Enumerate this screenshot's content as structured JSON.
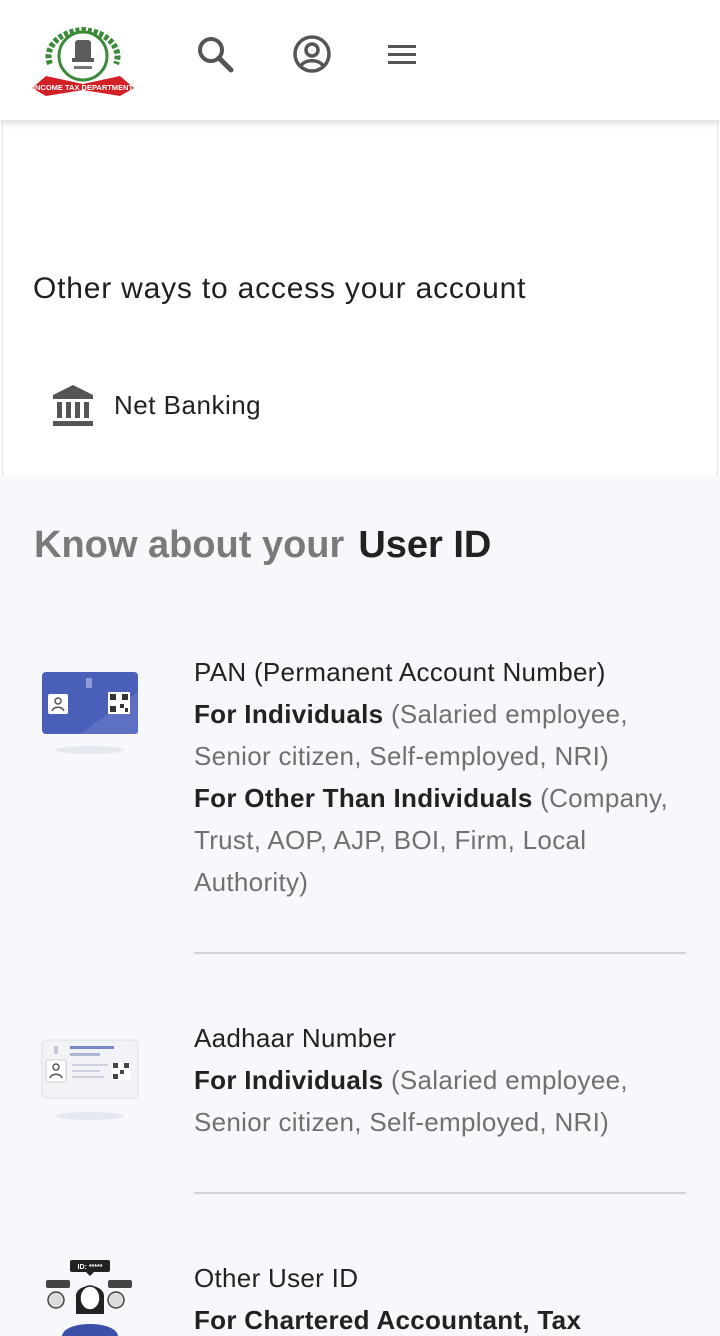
{
  "header": {
    "logo_text": "INCOME TAX DEPARTMENT",
    "icons": [
      "search-icon",
      "account-circle-icon",
      "menu-icon"
    ]
  },
  "access": {
    "heading": "Other ways to access your account",
    "net_banking": "Net Banking"
  },
  "know": {
    "title_muted": "Know about your",
    "title_strong": "User ID",
    "items": [
      {
        "title": "PAN (Permanent Account Number)",
        "lines": [
          {
            "bold": "For Individuals",
            "rest": " (Salaried employee, Senior citizen, Self-employed, NRI)"
          },
          {
            "bold": "For Other Than Individuals",
            "rest": " (Company, Trust, AOP, AJP, BOI, Firm, Local Authority)"
          }
        ]
      },
      {
        "title": "Aadhaar Number",
        "lines": [
          {
            "bold": "For Individuals",
            "rest": " (Salaried employee, Senior citizen, Self-employed, NRI)"
          }
        ]
      },
      {
        "title": "Other User ID",
        "lines": [
          {
            "bold": "For Chartered Accountant, Tax",
            "rest": ""
          }
        ]
      }
    ],
    "avatar_badge": "ID: *****"
  },
  "colors": {
    "pan_card_blue": "#4a5fb8",
    "section_bg": "#f7f8fc",
    "logo_red": "#d32027",
    "logo_green": "#3a8a3a"
  }
}
